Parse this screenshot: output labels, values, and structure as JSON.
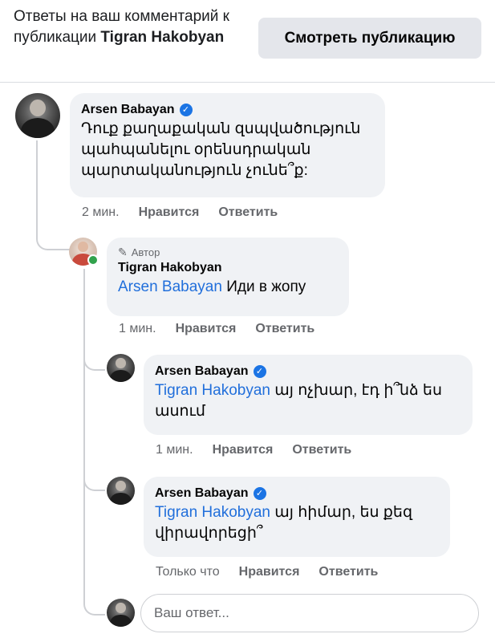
{
  "header": {
    "text_prefix": "Ответы на ваш комментарий к публикации",
    "author": "Tigran Hakobyan",
    "view_button": "Смотреть публикацию"
  },
  "comments": [
    {
      "name": "Arsen Babayan",
      "verified": true,
      "text": "Դուք քաղաքական զսպվածություն պահպանելու օրենսդրական պարտականություն չունե՞ք:",
      "time": "2 мин.",
      "like": "Нравится",
      "reply": "Ответить"
    },
    {
      "author_badge": "Автор",
      "name": "Tigran Hakobyan",
      "mention": "Arsen Babayan",
      "text": "Иди в жопу",
      "time": "1 мин.",
      "like": "Нравится",
      "reply": "Ответить"
    },
    {
      "name": "Arsen Babayan",
      "verified": true,
      "mention": "Tigran Hakobyan",
      "text": "այ ոչխար, էդ ի՞նձ ես ասում",
      "time": "1 мин.",
      "like": "Нравится",
      "reply": "Ответить"
    },
    {
      "name": "Arsen Babayan",
      "verified": true,
      "mention": "Tigran Hakobyan",
      "text": "այ հիմար, ես քեզ վիրավորեցի՞",
      "time": "Только что",
      "like": "Нравится",
      "reply": "Ответить"
    }
  ],
  "reply_input": {
    "placeholder": "Ваш ответ..."
  }
}
